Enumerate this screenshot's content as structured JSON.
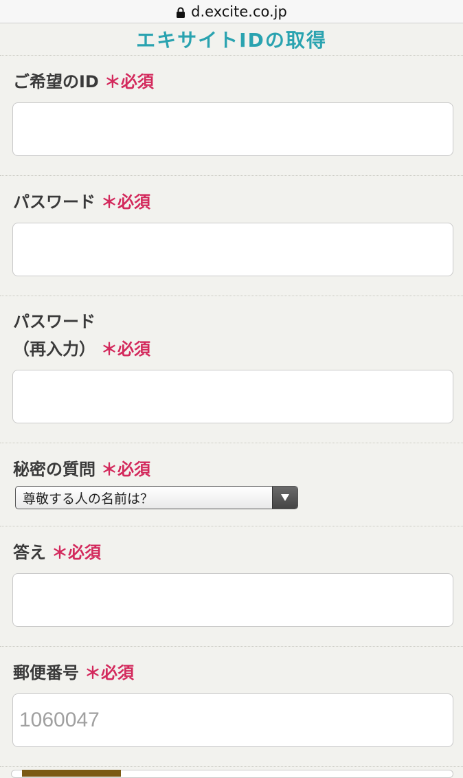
{
  "browser": {
    "url": "d.excite.co.jp"
  },
  "page": {
    "title": "エキサイトIDの取得"
  },
  "required_mark": "＊必須",
  "fields": {
    "desired_id": {
      "label": "ご希望のID",
      "value": "",
      "placeholder": ""
    },
    "password": {
      "label": "パスワード",
      "value": "",
      "placeholder": ""
    },
    "password_confirm": {
      "label_line1": "パスワード",
      "label_line2": "（再入力）",
      "value": "",
      "placeholder": ""
    },
    "secret_question": {
      "label": "秘密の質問",
      "selected": "尊敬する人の名前は？"
    },
    "answer": {
      "label": "答え",
      "value": "",
      "placeholder": ""
    },
    "postal_code": {
      "label": "郵便番号",
      "value": "",
      "placeholder": "1060047"
    }
  },
  "colors": {
    "title": "#2aa3b0",
    "required": "#d3295c",
    "background": "#f2f2ee"
  },
  "icons": {
    "lock": "lock-icon",
    "dropdown": "triangle-down-icon"
  }
}
